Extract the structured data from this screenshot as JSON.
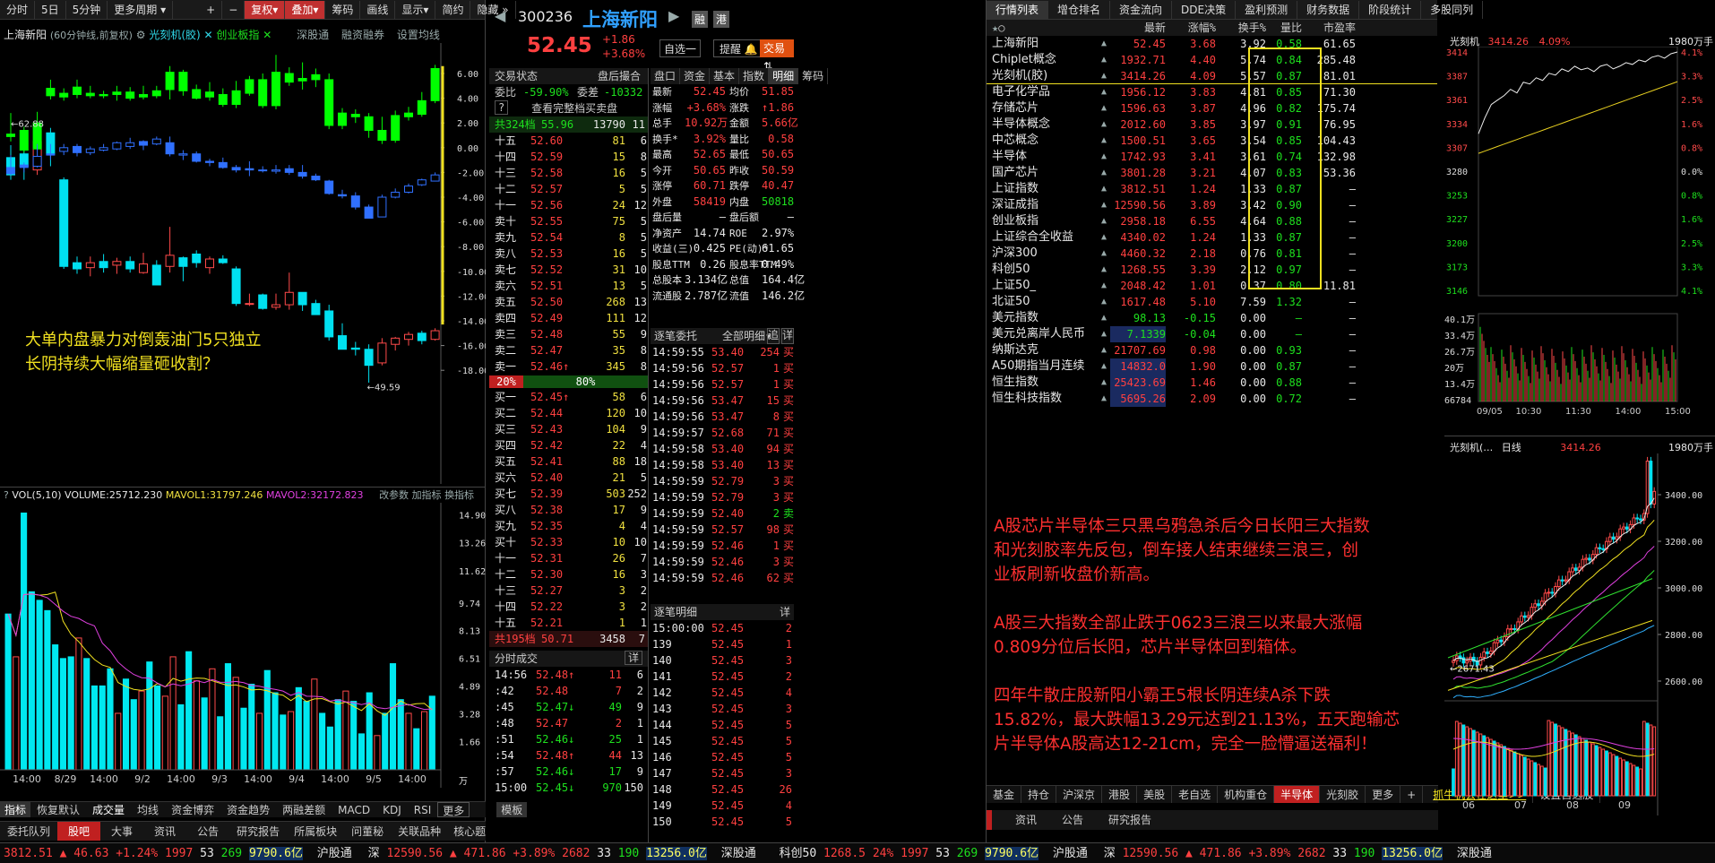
{
  "top_left_toolbar": [
    "分时",
    "5日",
    "5分钟",
    "更多周期",
    "+",
    "−",
    "复权",
    "叠加",
    "筹码",
    "画线",
    "显示",
    "简约",
    "隐藏"
  ],
  "kline": {
    "title": "上海新阳",
    "desc": "(60分钟线,前复权)",
    "overlay1": "光刻机(胶)",
    "overlay2": "创业板指",
    "links": [
      "深股通",
      "融资融券",
      "设置均线"
    ],
    "y_ticks": [
      "6.00",
      "4.00",
      "2.00",
      "0.00",
      "-2.00",
      "-4.00",
      "-6.00",
      "-8.00",
      "-10.00",
      "-12.00",
      "-14.00",
      "-16.00",
      "-18.00"
    ],
    "high_mark": "←62.88",
    "low_mark": "←49.59",
    "annotation1": "大单内盘暴力对倒轰油门5只独立",
    "annotation2": "长阴持续大幅缩量砸收割？"
  },
  "vol": {
    "label": "VOL(5,10)",
    "volume": "VOLUME:25712.230",
    "mavol1": "MAVOL1:31797.246",
    "mavol2": "MAVOL2:32172.823",
    "links": [
      "改参数",
      "加指标",
      "换指标"
    ],
    "y_ticks": [
      "14.90",
      "13.26",
      "11.62",
      "9.74",
      "8.13",
      "6.51",
      "4.89",
      "3.28",
      "1.66",
      "万"
    ],
    "x_ticks": [
      "14:00",
      "8/29",
      "14:00",
      "9/2",
      "14:00",
      "9/3",
      "14:00",
      "9/4",
      "14:00",
      "9/5",
      "14:00"
    ],
    "bars": [
      9.1,
      6.6,
      15,
      10.4,
      9.9,
      9.3,
      7.3,
      6.5,
      6.6,
      7.7,
      6.5,
      4.9,
      4.9,
      5.9,
      3.3,
      5.3,
      4.1,
      4.6,
      6.3,
      4.9,
      4.3,
      6.6,
      3.8,
      6.9,
      5.2,
      4.2,
      5.9,
      3.1,
      6.2,
      5.4,
      3.6,
      5.0,
      3.3,
      5.8,
      4.5,
      3.2,
      3.4,
      4.8,
      4.0,
      5.3,
      3.3,
      2.5,
      4.1,
      4.6,
      4.0,
      2.1,
      4.5,
      2.0,
      3.3,
      6.2,
      4.1,
      3.3,
      2.4,
      3.4,
      4.3
    ]
  },
  "indicator_tabs": [
    "指标",
    "恢复默认",
    "成交量",
    "均线",
    "资金博弈",
    "资金趋势",
    "两融差额",
    "MACD",
    "KDJ",
    "RSI",
    "更多",
    "模板"
  ],
  "bottom_tabs_left": [
    "委托队列",
    "股吧",
    "大事",
    "资讯",
    "公告",
    "研究报告",
    "所属板块",
    "问董秘",
    "关联品种",
    "核心题"
  ],
  "quote": {
    "code": "300236",
    "name": "上海新阳",
    "price": "52.45",
    "chg": "+1.86",
    "pct": "+3.68%",
    "btns": [
      "融",
      "港"
    ],
    "tool_btns": [
      "自选一",
      "提醒",
      "交易"
    ],
    "stat_label": "交易状态",
    "stat_val": "盘后撮合",
    "wb_label": "委比",
    "wb_val": "-59.90%",
    "wc_label": "委差",
    "wc_val": "-10332",
    "view_all": "查看完整档买卖盘",
    "total_ask": "共324档",
    "total_ask_p": "55.96",
    "total_ask_v": "13790",
    "total_ask_n": "11",
    "total_bid": "共195档",
    "total_bid_p": "50.71",
    "total_bid_v": "3458",
    "total_bid_n": "7",
    "ratio_l": "20%",
    "ratio_r": "80%"
  },
  "asks": [
    [
      "十五",
      "52.60",
      "81",
      "6"
    ],
    [
      "十四",
      "52.59",
      "15",
      "8"
    ],
    [
      "十三",
      "52.58",
      "16",
      "5"
    ],
    [
      "十二",
      "52.57",
      "5",
      "5"
    ],
    [
      "十一",
      "52.56",
      "24",
      "12"
    ],
    [
      "卖十",
      "52.55",
      "75",
      "5"
    ],
    [
      "卖九",
      "52.54",
      "8",
      "5"
    ],
    [
      "卖八",
      "52.53",
      "16",
      "5"
    ],
    [
      "卖七",
      "52.52",
      "31",
      "10"
    ],
    [
      "卖六",
      "52.51",
      "13",
      "5"
    ],
    [
      "卖五",
      "52.50",
      "268",
      "13"
    ],
    [
      "卖四",
      "52.49",
      "111",
      "12"
    ],
    [
      "卖三",
      "52.48",
      "55",
      "9"
    ],
    [
      "卖二",
      "52.47",
      "35",
      "8"
    ],
    [
      "卖一",
      "52.46↑",
      "345",
      "8"
    ]
  ],
  "bids": [
    [
      "买一",
      "52.45↑",
      "58",
      "6"
    ],
    [
      "买二",
      "52.44",
      "120",
      "10"
    ],
    [
      "买三",
      "52.43",
      "104",
      "9"
    ],
    [
      "买四",
      "52.42",
      "22",
      "4"
    ],
    [
      "买五",
      "52.41",
      "88",
      "18"
    ],
    [
      "买六",
      "52.40",
      "21",
      "5"
    ],
    [
      "买七",
      "52.39",
      "503",
      "252"
    ],
    [
      "买八",
      "52.38",
      "17",
      "9"
    ],
    [
      "买九",
      "52.35",
      "4",
      "4"
    ],
    [
      "买十",
      "52.33",
      "10",
      "10"
    ],
    [
      "十一",
      "52.31",
      "26",
      "7"
    ],
    [
      "十二",
      "52.30",
      "16",
      "3"
    ],
    [
      "十三",
      "52.27",
      "3",
      "2"
    ],
    [
      "十四",
      "52.22",
      "3",
      "2"
    ],
    [
      "十五",
      "52.21",
      "1",
      "1"
    ]
  ],
  "ticks_title": "分时成交",
  "ticks_detail": "详",
  "ticks": [
    [
      "14:56",
      "52.48↑",
      "11",
      "6"
    ],
    [
      ":42",
      "52.48",
      "7",
      "2"
    ],
    [
      ":45",
      "52.47↓",
      "49",
      "9"
    ],
    [
      ":48",
      "52.47",
      "2",
      "1"
    ],
    [
      ":51",
      "52.46↓",
      "25",
      "1"
    ],
    [
      ":54",
      "52.48↑",
      "44",
      "13"
    ],
    [
      ":57",
      "52.46↓",
      "17",
      "9"
    ],
    [
      "15:00",
      "52.45↓",
      "970",
      "150"
    ]
  ],
  "stats_tabs": [
    "盘口",
    "资金",
    "基本",
    "指数",
    "明细",
    "筹码"
  ],
  "stats": [
    [
      "最新",
      "52.45",
      "均价",
      "51.85"
    ],
    [
      "涨幅",
      "+3.68%",
      "涨跌",
      "↑1.86"
    ],
    [
      "总手",
      "10.92万",
      "金额",
      "5.66亿"
    ],
    [
      "换手*",
      "3.92%",
      "量比",
      "0.58"
    ],
    [
      "最高",
      "52.65",
      "最低",
      "50.65"
    ],
    [
      "今开",
      "50.65",
      "昨收",
      "50.59"
    ],
    [
      "涨停",
      "60.71",
      "跌停",
      "40.47"
    ],
    [
      "外盘",
      "58419",
      "内盘",
      "50818"
    ],
    [
      "盘后量",
      "—",
      "盘后额",
      "—"
    ],
    [
      "净资产",
      "14.74",
      "ROE",
      "2.97%"
    ],
    [
      "收益(三)",
      "0.425",
      "PE(动)*",
      "61.65"
    ],
    [
      "股息TTM",
      "0.26",
      "股息率TTM",
      "0.49%"
    ],
    [
      "总股本",
      "3.134亿",
      "总值",
      "164.4亿"
    ],
    [
      "流通股",
      "2.787亿",
      "流值",
      "146.2亿"
    ]
  ],
  "entrust_title": "逐笔委托",
  "entrust_filter": "全部明细",
  "entrust_btns": [
    "追",
    "详"
  ],
  "entrust": [
    [
      "14:59:55",
      "53.40",
      "254",
      "买"
    ],
    [
      "14:59:56",
      "52.57",
      "1",
      "买"
    ],
    [
      "14:59:56",
      "52.57",
      "1",
      "买"
    ],
    [
      "14:59:56",
      "53.47",
      "15",
      "买"
    ],
    [
      "14:59:56",
      "53.47",
      "8",
      "买"
    ],
    [
      "14:59:57",
      "52.68",
      "71",
      "买"
    ],
    [
      "14:59:58",
      "53.40",
      "94",
      "买"
    ],
    [
      "14:59:58",
      "53.40",
      "13",
      "买"
    ],
    [
      "14:59:59",
      "52.79",
      "3",
      "买"
    ],
    [
      "14:59:59",
      "52.79",
      "3",
      "买"
    ],
    [
      "14:59:59",
      "52.40",
      "2",
      "卖"
    ],
    [
      "14:59:59",
      "52.57",
      "98",
      "买"
    ],
    [
      "14:59:59",
      "52.46",
      "1",
      "买"
    ],
    [
      "14:59:59",
      "52.46",
      "3",
      "买"
    ],
    [
      "14:59:59",
      "52.46",
      "62",
      "买"
    ]
  ],
  "detail_title": "逐笔明细",
  "detail_btn": "详",
  "detail": [
    [
      "15:00:00",
      "52.45",
      "2"
    ],
    [
      "139",
      "52.45",
      "1"
    ],
    [
      "140",
      "52.45",
      "3"
    ],
    [
      "141",
      "52.45",
      "2"
    ],
    [
      "142",
      "52.45",
      "4"
    ],
    [
      "143",
      "52.45",
      "3"
    ],
    [
      "144",
      "52.45",
      "5"
    ],
    [
      "145",
      "52.45",
      "5"
    ],
    [
      "146",
      "52.45",
      "5"
    ],
    [
      "147",
      "52.45",
      "3"
    ],
    [
      "148",
      "52.45",
      "26"
    ],
    [
      "149",
      "52.45",
      "4"
    ],
    [
      "150",
      "52.45",
      "5"
    ]
  ],
  "list_tabs": [
    "行情列表",
    "增仓排名",
    "资金流向",
    "DDE决策",
    "盈利预测",
    "财务数据",
    "阶段统计",
    "多股同列"
  ],
  "list_header": [
    "最新",
    "涨幅%",
    "换手%",
    "量比",
    "市盈率"
  ],
  "list": [
    [
      "上海新阳",
      "52.45",
      "3.68",
      "3.92",
      "0.58",
      "61.65"
    ],
    [
      "Chiplet概念",
      "1932.71",
      "4.40",
      "5.74",
      "0.84",
      "285.48"
    ],
    [
      "光刻机(胶)",
      "3414.26",
      "4.09",
      "5.57",
      "0.87",
      "81.01"
    ],
    [
      "电子化学品",
      "1956.12",
      "3.83",
      "4.81",
      "0.85",
      "71.30"
    ],
    [
      "存储芯片",
      "1596.63",
      "3.87",
      "4.96",
      "0.82",
      "175.74"
    ],
    [
      "半导体概念",
      "2012.60",
      "3.85",
      "3.97",
      "0.91",
      "76.95"
    ],
    [
      "中芯概念",
      "1500.51",
      "3.65",
      "3.54",
      "0.85",
      "104.43"
    ],
    [
      "半导体",
      "1742.93",
      "3.41",
      "3.61",
      "0.74",
      "132.98"
    ],
    [
      "国产芯片",
      "3801.28",
      "3.21",
      "4.07",
      "0.83",
      "53.36"
    ],
    [
      "上证指数",
      "3812.51",
      "1.24",
      "1.33",
      "0.87",
      "—"
    ],
    [
      "深证成指",
      "12590.56",
      "3.89",
      "3.42",
      "0.90",
      "—"
    ],
    [
      "创业板指",
      "2958.18",
      "6.55",
      "4.64",
      "0.88",
      "—"
    ],
    [
      "上证综合全收益",
      "4340.02",
      "1.24",
      "1.33",
      "0.87",
      "—"
    ],
    [
      "沪深300",
      "4460.32",
      "2.18",
      "0.76",
      "0.81",
      "—"
    ],
    [
      "科创50",
      "1268.55",
      "3.39",
      "2.12",
      "0.97",
      "—"
    ],
    [
      "上证50_",
      "2048.42",
      "1.01",
      "0.37",
      "0.80",
      "11.81"
    ],
    [
      "北证50",
      "1617.48",
      "5.10",
      "7.59",
      "1.32",
      "—"
    ],
    [
      "美元指数",
      "98.13",
      "-0.15",
      "0.00",
      "—",
      "—"
    ],
    [
      "美元兑离岸人民币",
      "7.1339",
      "-0.04",
      "0.00",
      "—",
      "—"
    ],
    [
      "纳斯达克",
      "21707.69",
      "0.98",
      "0.00",
      "0.93",
      "—"
    ],
    [
      "A50期指当月连续",
      "14832.0",
      "1.90",
      "0.00",
      "0.87",
      "—"
    ],
    [
      "恒生指数",
      "25423.69",
      "1.46",
      "0.00",
      "0.88",
      "—"
    ],
    [
      "恒生科技指数",
      "5695.26",
      "2.09",
      "0.00",
      "0.72",
      "—"
    ]
  ],
  "right_ann": [
    "A股芯片半导体三只黑乌鸦急杀后今日长阳三大指数",
    "和光刻胶率先反包，倒车接人结束继续三浪三，创",
    "业板刷新收盘价新高。",
    "",
    "A股三大指数全部止跌于0623三浪三以来最大涨幅",
    "0.809分位后长阳，芯片半导体回到箱体。",
    "",
    "四年牛散庄股新阳小霸王5根长阴连续A杀下跌",
    "15.82%，最大跌幅13.29元达到21.13%，五天跑输芯",
    "片半导体A股高达12-21cm，完全一脸懵逼送福利！"
  ],
  "list_bottom_tabs": [
    "基金",
    "持仓",
    "沪深京",
    "港股",
    "美股",
    "老自选",
    "机构重仓",
    "半导体",
    "光刻胶",
    "更多",
    "+",
    "抓牛机会在这里>>",
    "设置自选股"
  ],
  "list_info_tabs": [
    "资讯",
    "公告",
    "研究报告"
  ],
  "mini": {
    "title": "光刻机",
    "price": "3414.26",
    "pct": "4.09%",
    "vol_unit": "1980万手",
    "y_left": [
      "3414",
      "3387",
      "3361",
      "3334",
      "3307",
      "3280",
      "3253",
      "3227",
      "3200",
      "3173",
      "3146"
    ],
    "y_right": [
      "4.1%",
      "3.3%",
      "2.5%",
      "1.6%",
      "0.8%",
      "0.0%",
      "0.8%",
      "1.6%",
      "2.5%",
      "3.3%",
      "4.1%"
    ],
    "vol_ticks": [
      "40.1万",
      "33.4万",
      "26.7万",
      "20万",
      "13.4万",
      "66784"
    ],
    "x_ticks": [
      "09/05",
      "10:30",
      "11:30",
      "14:00",
      "15:00"
    ]
  },
  "daily": {
    "title": "光刻机(…",
    "period": "日线",
    "price": "3414.26",
    "vol_unit": "1980万手",
    "peak": "3544.81",
    "low": "←2671.43",
    "y_ticks": [
      "3400.00",
      "3200.00",
      "3000.00",
      "2800.00",
      "2600.00"
    ],
    "x_ticks": [
      "06",
      "07",
      "08",
      "09"
    ]
  },
  "statusbar": {
    "sh": "3812.51",
    "sh_chg": "▲ 46.63 +1.24%",
    "sh_n1": "1997",
    "sh_n2": "53",
    "sh_n3": "269",
    "sh_amt": "9790.6亿",
    "hgt": "沪股通",
    "sz_label": "深",
    "sz": "12590.56",
    "sz_chg": "▲ 471.86 +3.89%",
    "sz_n1": "2682",
    "sz_n2": "33",
    "sz_n3": "190",
    "sz_amt": "13256.0亿",
    "sgt": "深股通",
    "kc": "科创50",
    "kc_v": "1268.5",
    "r_pct": "24%",
    "r_n1": "1997",
    "r_n2": "53",
    "r_n3": "269",
    "r_amt": "9790.6亿",
    "r_hgt": "沪股通",
    "r_sz_label": "深",
    "r_sz": "12590.56",
    "r_sz_chg": "▲ 471.86 +3.89%",
    "r_sz_n1": "2682",
    "r_sz_n2": "33",
    "r_sz_n3": "190",
    "r_sz_amt": "13256.0亿",
    "r_sgt": "深股通"
  }
}
